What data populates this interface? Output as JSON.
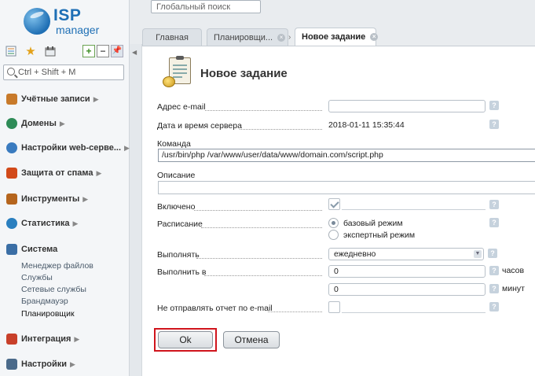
{
  "logo": {
    "brand": "ISP",
    "sub": "manager"
  },
  "sidebar": {
    "search_placeholder": "Ctrl + Shift + M",
    "items": [
      {
        "label": "Учётные записи",
        "icon": "users-icon",
        "color": "#c87a2a"
      },
      {
        "label": "Домены",
        "icon": "globe-icon",
        "color": "#2e8b57"
      },
      {
        "label": "Настройки web-серве...",
        "icon": "web-settings-icon",
        "color": "#3a7bbf"
      },
      {
        "label": "Защита от спама",
        "icon": "shield-icon",
        "color": "#d24a1a"
      },
      {
        "label": "Инструменты",
        "icon": "tools-icon",
        "color": "#b5651d"
      },
      {
        "label": "Статистика",
        "icon": "chart-icon",
        "color": "#2a7fbf"
      },
      {
        "label": "Система",
        "icon": "system-icon",
        "color": "#3a6ea5"
      },
      {
        "label": "Интеграция",
        "icon": "integration-icon",
        "color": "#c8402a"
      },
      {
        "label": "Настройки",
        "icon": "settings-icon",
        "color": "#4a6a8a"
      }
    ],
    "system_sub": [
      "Менеджер файлов",
      "Службы",
      "Сетевые службы",
      "Брандмауэр",
      "Планировщик"
    ]
  },
  "topbar": {
    "search_placeholder": "Глобальный поиск"
  },
  "tabs": [
    {
      "label": "Главная"
    },
    {
      "label": "Планировщи..."
    },
    {
      "label": "Новое задание"
    }
  ],
  "form": {
    "title": "Новое задание",
    "email_label": "Адрес e-mail",
    "email_value": "",
    "datetime_label": "Дата и время сервера",
    "datetime_value": "2018-01-11 15:35:44",
    "command_label": "Команда",
    "command_value": "/usr/bin/php /var/www/user/data/www/domain.com/script.php",
    "description_label": "Описание",
    "description_value": "",
    "enabled_label": "Включено",
    "enabled": true,
    "schedule_label": "Расписание",
    "schedule_options": [
      "базовый режим",
      "экспертный режим"
    ],
    "schedule_selected": "базовый режим",
    "execute_label": "Выполнять",
    "execute_value": "ежедневно",
    "run_at_label": "Выполнить в",
    "hours_value": "0",
    "hours_unit": "часов",
    "minutes_value": "0",
    "minutes_unit": "минут",
    "no_report_label": "Не отправлять отчет по e-mail",
    "no_report": false,
    "help": "?"
  },
  "buttons": {
    "ok": "Ok",
    "cancel": "Отмена"
  }
}
